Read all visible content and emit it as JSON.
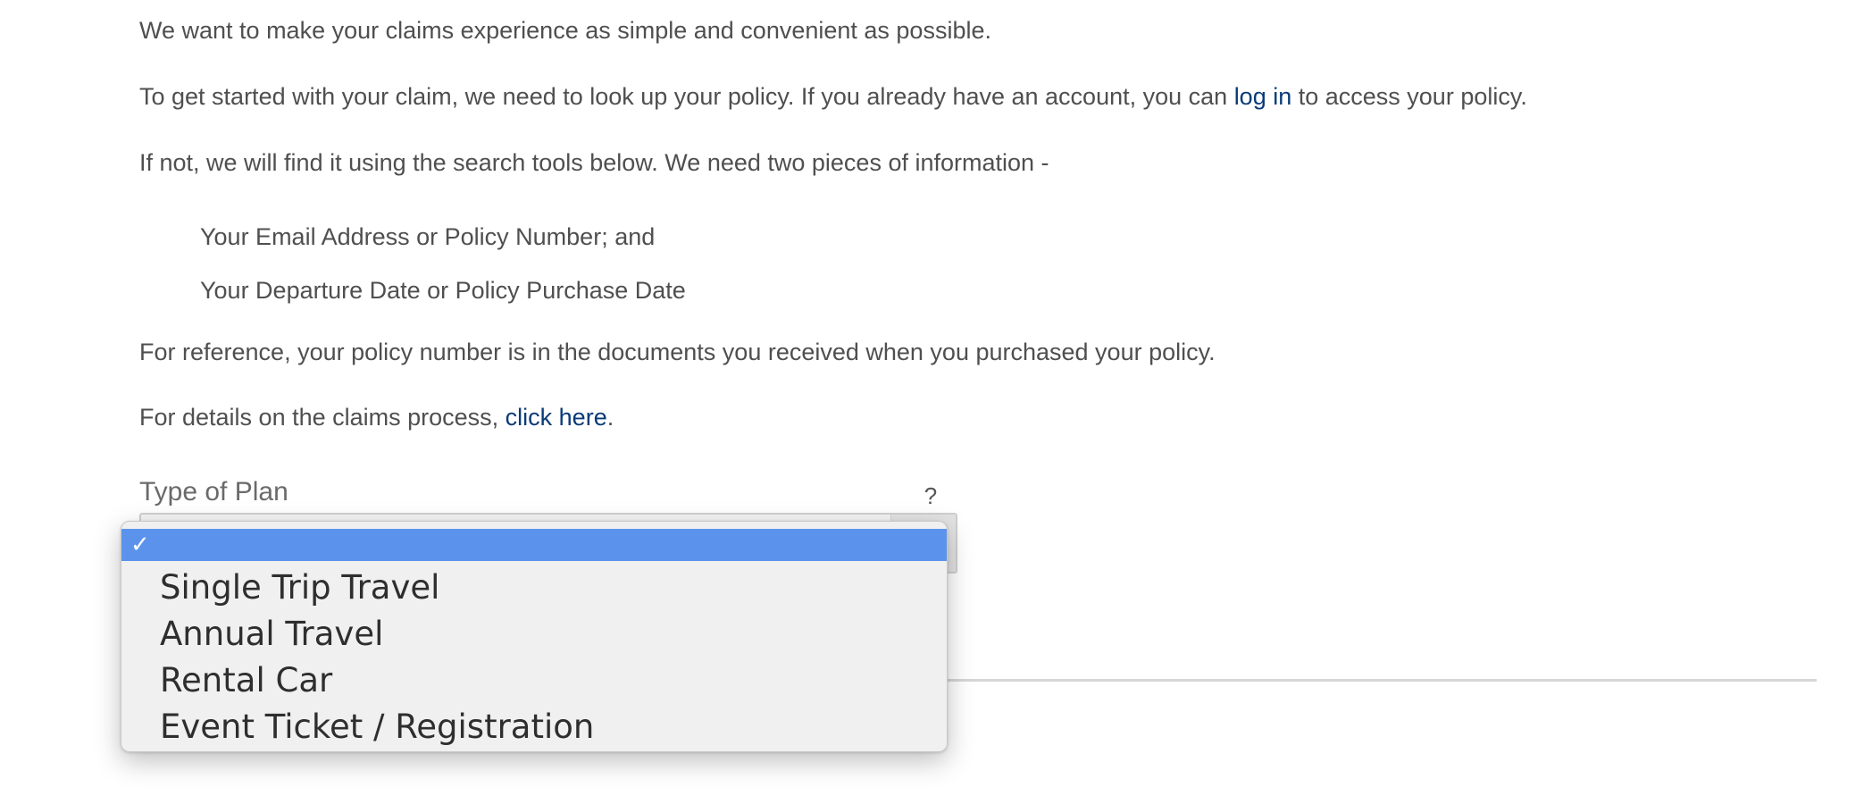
{
  "intro": {
    "line1": "We want to make your claims experience as simple and convenient as possible.",
    "line2_before": "To get started with your claim, we need to look up your policy. If you already have an account, you can ",
    "line2_link": "log in",
    "line2_after": " to access your policy.",
    "line3": "If not, we will find it using the search tools below. We need two pieces of information -",
    "item1": "Your Email Address or Policy Number; and",
    "item2": "Your Departure Date or Policy Purchase Date",
    "line4": "For reference, your policy number is in the documents you received when you purchased your policy.",
    "line5_before": "For details on the claims process, ",
    "line5_link": "click here",
    "line5_after": "."
  },
  "plan_field": {
    "label": "Type of Plan",
    "help": "?",
    "selected_value": ""
  },
  "dropdown": {
    "check": "✓",
    "options": [
      {
        "label": ""
      },
      {
        "label": "Single Trip Travel"
      },
      {
        "label": "Annual Travel"
      },
      {
        "label": "Rental Car"
      },
      {
        "label": "Event Ticket / Registration"
      }
    ],
    "highlight_color": "#5b93ec",
    "link_color": "#0a3a78"
  }
}
